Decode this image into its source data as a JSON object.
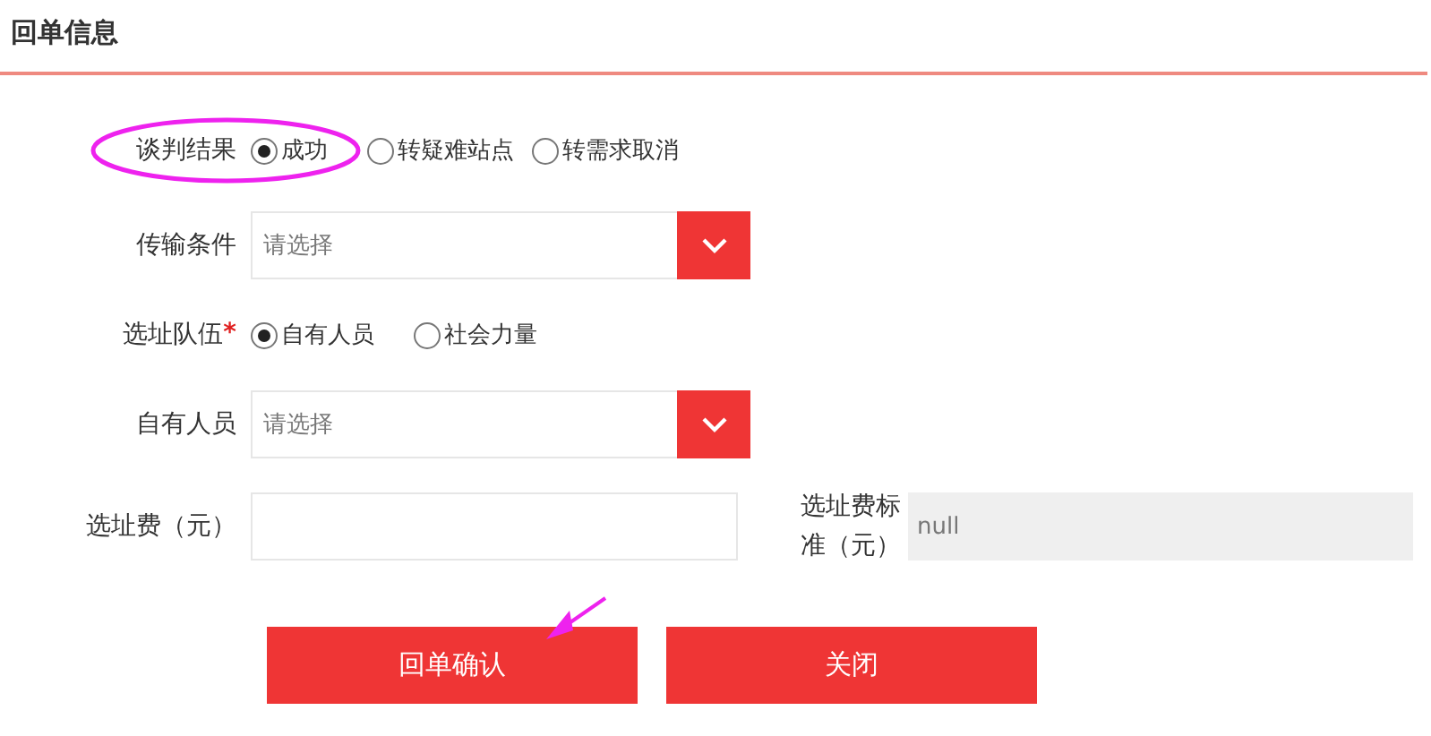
{
  "section_title": "回单信息",
  "negotiation": {
    "label": "谈判结果",
    "options": [
      {
        "label": "成功",
        "selected": true
      },
      {
        "label": "转疑难站点",
        "selected": false
      },
      {
        "label": "转需求取消",
        "selected": false
      }
    ]
  },
  "transport": {
    "label": "传输条件",
    "placeholder": "请选择"
  },
  "team": {
    "label": "选址队伍",
    "required_mark": "*",
    "options": [
      {
        "label": "自有人员",
        "selected": true
      },
      {
        "label": "社会力量",
        "selected": false
      }
    ]
  },
  "staff": {
    "label": "自有人员",
    "placeholder": "请选择"
  },
  "fee": {
    "label": "选址费（元）"
  },
  "fee_standard": {
    "label": "选址费标准（元）",
    "value": "null"
  },
  "buttons": [
    "回单确认",
    "关闭"
  ]
}
